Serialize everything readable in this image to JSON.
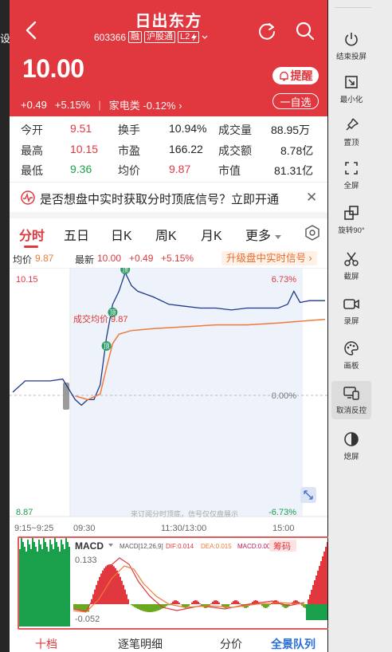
{
  "left_app": {
    "text": "设"
  },
  "header": {
    "title": "日出东方",
    "code": "603366",
    "tags": [
      "融",
      "沪股通",
      "L2"
    ],
    "price": "10.00",
    "change": "+0.49",
    "change_pct": "+5.15%",
    "sector": "家电类",
    "sector_pct": "-0.12%",
    "remind_label": "提醒",
    "watchlist_label": "一自选"
  },
  "stats": {
    "open": {
      "label": "今开",
      "value": "9.51"
    },
    "turnover": {
      "label": "换手",
      "value": "10.94%"
    },
    "volume": {
      "label": "成交量",
      "value": "88.95万"
    },
    "high": {
      "label": "最高",
      "value": "10.15"
    },
    "pe": {
      "label": "市盈",
      "value": "166.22"
    },
    "amount": {
      "label": "成交额",
      "value": "8.78亿"
    },
    "low": {
      "label": "最低",
      "value": "9.36"
    },
    "avg": {
      "label": "均价",
      "value": "9.87"
    },
    "mcap": {
      "label": "市值",
      "value": "81.31亿"
    }
  },
  "promo": {
    "text": "是否想盘中实时获取分时顶底信号？立即开通",
    "close": "✕"
  },
  "tabs": [
    {
      "label": "分时",
      "active": true
    },
    {
      "label": "五日"
    },
    {
      "label": "日K"
    },
    {
      "label": "周K"
    },
    {
      "label": "月K"
    },
    {
      "label": "更多"
    }
  ],
  "info": {
    "avg_label": "均价",
    "avg_value": "9.87",
    "latest_label": "最新",
    "latest_value": "10.00",
    "change": "+0.49",
    "change_pct": "+5.15%",
    "upgrade": "升级盘中实时信号 ›"
  },
  "chart_data": [
    {
      "type": "line",
      "title": "",
      "y_max_label": "10.15",
      "y_min_label": "8.87",
      "pct_max_label": "6.73%",
      "pct_zero_label": "0.00%",
      "pct_min_label": "-6.73%",
      "prev_close": 9.51,
      "ylim": [
        8.87,
        10.15
      ],
      "x_ticks": [
        "9:15~9:25",
        "09:30",
        "11:30/13:00",
        "15:00"
      ],
      "avg_annotation": "成交均价 9.87",
      "signals": [
        "顶",
        "顶",
        "顶"
      ],
      "watermark": "来订阅分时顶底，信号仅仅盘展示",
      "series": [
        {
          "name": "最新",
          "color": "#1e3a8a",
          "x": [
            0,
            0.04,
            0.08,
            0.12,
            0.16,
            0.2,
            0.22,
            0.24,
            0.26,
            0.28,
            0.3,
            0.32,
            0.34,
            0.36,
            0.38,
            0.4,
            0.45,
            0.5,
            0.55,
            0.6,
            0.65,
            0.7,
            0.75,
            0.8,
            0.85,
            0.88,
            0.9,
            0.92,
            0.95,
            1.0
          ],
          "values": [
            9.51,
            9.57,
            9.57,
            9.57,
            9.58,
            9.47,
            9.44,
            9.47,
            9.47,
            9.55,
            9.8,
            9.98,
            10.05,
            10.15,
            10.08,
            10.05,
            10.02,
            9.98,
            9.97,
            9.96,
            9.96,
            9.95,
            9.96,
            9.96,
            9.96,
            9.98,
            10.05,
            9.99,
            10.0,
            10.0
          ]
        },
        {
          "name": "均价",
          "color": "#f07a3a",
          "x": [
            0.2,
            0.24,
            0.28,
            0.3,
            0.32,
            0.34,
            0.38,
            0.45,
            0.55,
            0.65,
            0.75,
            0.85,
            1.0
          ],
          "values": [
            9.49,
            9.47,
            9.5,
            9.64,
            9.77,
            9.82,
            9.84,
            9.85,
            9.86,
            9.87,
            9.87,
            9.88,
            9.9
          ]
        }
      ]
    },
    {
      "type": "bar",
      "indicator": "MACD",
      "params": "MACD[12,26,9]",
      "dif_label": "DIF:0.014",
      "dea_label": "DEA:0.015",
      "macd_label": "MACD:0.003",
      "chip_label": "筹码",
      "y_max_label": "0.133",
      "y_min_label": "-0.052",
      "ylim": [
        -0.052,
        0.133
      ]
    }
  ],
  "bottom_nav": [
    {
      "label": "十档"
    },
    {
      "label": "逐笔明细"
    },
    {
      "label": "分价"
    },
    {
      "label": "全景队列"
    }
  ],
  "toolbar": [
    {
      "label": "结束投屏",
      "icon": "power-icon"
    },
    {
      "label": "最小化",
      "icon": "minimize-icon"
    },
    {
      "label": "置顶",
      "icon": "pin-icon"
    },
    {
      "label": "全屏",
      "icon": "fullscreen-icon"
    },
    {
      "label": "旋转90°",
      "icon": "rotate-icon"
    },
    {
      "label": "截屏",
      "icon": "scissors-icon"
    },
    {
      "label": "录屏",
      "icon": "record-icon"
    },
    {
      "label": "画板",
      "icon": "palette-icon"
    },
    {
      "label": "取消反控",
      "icon": "remote-control-icon"
    },
    {
      "label": "熄屏",
      "icon": "screen-off-icon"
    }
  ]
}
